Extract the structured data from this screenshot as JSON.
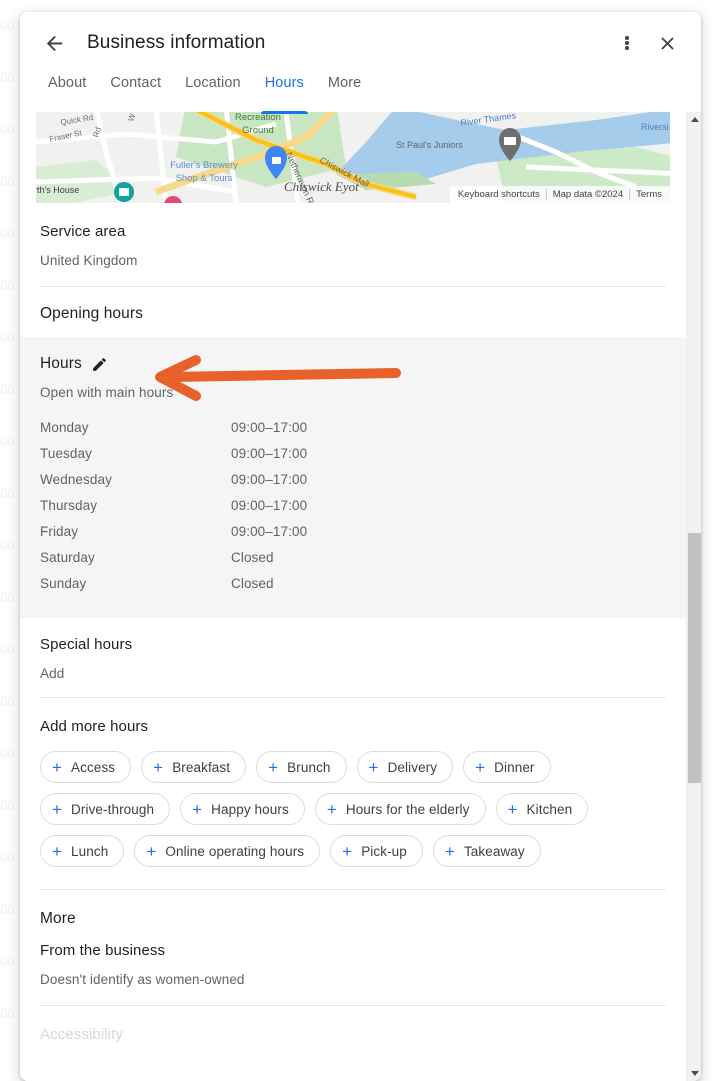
{
  "window": {
    "title": "Business information",
    "back_icon": "back-arrow-icon",
    "overflow_icon": "more-vert-icon",
    "close_icon": "close-icon"
  },
  "tabs": [
    {
      "label": "About",
      "active": false
    },
    {
      "label": "Contact",
      "active": false
    },
    {
      "label": "Location",
      "active": false
    },
    {
      "label": "Hours",
      "active": true
    },
    {
      "label": "More",
      "active": false
    }
  ],
  "map": {
    "labels": [
      "Quick Rd",
      "Fraser St",
      "Recreation",
      "Ground",
      "River Thames",
      "Riversi",
      "St Paul's Juniors",
      "Netheravon Rd S",
      "Chiswick Mall",
      "Fuller's Brewery",
      "Shop & Tours",
      "Chiswick Eyot",
      "rth's House"
    ],
    "credit": {
      "keyboard_shortcuts": "Keyboard shortcuts",
      "map_data": "Map data ©2024",
      "terms": "Terms"
    }
  },
  "service_area": {
    "heading": "Service area",
    "value": "United Kingdom"
  },
  "opening_hours": {
    "heading": "Opening hours",
    "hours": {
      "label": "Hours",
      "edit_icon": "pencil-icon",
      "status": "Open with main hours",
      "rows": [
        {
          "day": "Monday",
          "value": "09:00–17:00"
        },
        {
          "day": "Tuesday",
          "value": "09:00–17:00"
        },
        {
          "day": "Wednesday",
          "value": "09:00–17:00"
        },
        {
          "day": "Thursday",
          "value": "09:00–17:00"
        },
        {
          "day": "Friday",
          "value": "09:00–17:00"
        },
        {
          "day": "Saturday",
          "value": "Closed"
        },
        {
          "day": "Sunday",
          "value": "Closed"
        }
      ]
    },
    "special_hours": {
      "label": "Special hours",
      "add": "Add"
    },
    "add_more_hours": {
      "label": "Add more hours",
      "chips": [
        "Access",
        "Breakfast",
        "Brunch",
        "Delivery",
        "Dinner",
        "Drive-through",
        "Happy hours",
        "Hours for the elderly",
        "Kitchen",
        "Lunch",
        "Online operating hours",
        "Pick-up",
        "Takeaway"
      ]
    }
  },
  "more": {
    "heading": "More",
    "from_the_business": {
      "label": "From the business",
      "value": "Doesn't identify as women-owned"
    }
  },
  "annotation": {
    "shape": "left-arrow",
    "color": "#e8612a",
    "points_at": "Hours"
  },
  "colors": {
    "accent_blue": "#1a73e8",
    "text_primary": "#202124",
    "text_secondary": "#5f6368",
    "highlight_bg": "#f5f5f5",
    "annotation_orange": "#e8612a"
  }
}
